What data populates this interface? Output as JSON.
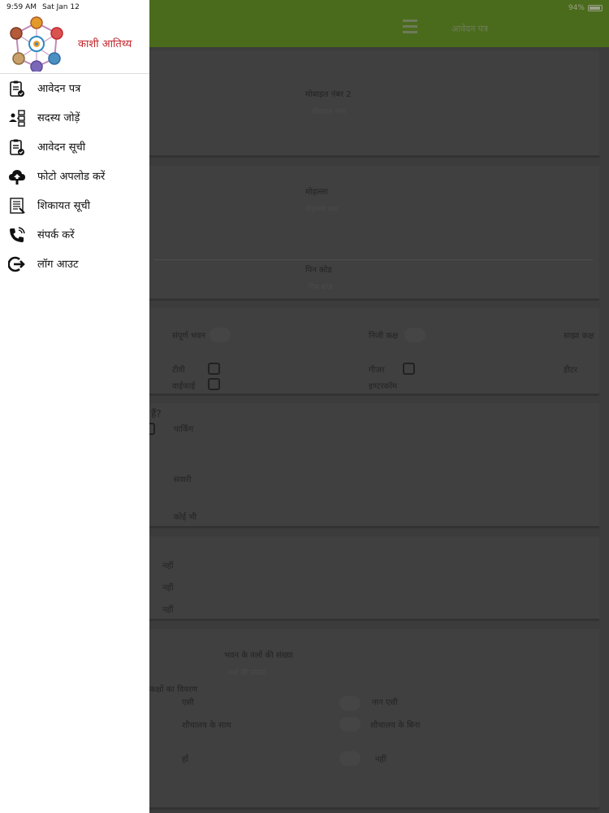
{
  "status_bar": {
    "time": "9:59 AM",
    "date": "Sat Jan 12",
    "battery": "94%"
  },
  "drawer": {
    "brand_name": "काशी आतिथ्य",
    "menu": [
      {
        "label": "आवेदन पत्र",
        "icon": "clipboard-check-icon"
      },
      {
        "label": "सदस्य जोड़ें",
        "icon": "add-member-icon"
      },
      {
        "label": "आवेदन सूची",
        "icon": "clipboard-list-icon"
      },
      {
        "label": "फोटो अपलोड करें",
        "icon": "cloud-upload-icon"
      },
      {
        "label": "शिकायत सूची",
        "icon": "document-list-icon"
      },
      {
        "label": "संपर्क करें",
        "icon": "phone-icon"
      },
      {
        "label": "लॉग आउट",
        "icon": "logout-icon"
      }
    ]
  },
  "background": {
    "header_title": "आवेदन पत्र",
    "mobile2_label": "मोबाइल नंबर 2",
    "mobile2_placeholder": "मोबाइल नंबर",
    "mohalla_label": "मोहल्ला",
    "mohalla_placeholder": "मोहल्ला नाम",
    "pincode_label": "पिन कोड",
    "pincode_placeholder": "पिन कोड",
    "room_types": [
      "संपूर्ण भवन",
      "निजी कक्ष",
      "साझा कक्ष"
    ],
    "amenities": [
      "टीवी",
      "गीजर",
      "हीटर",
      "वाईफाई",
      "इण्टरकॉम"
    ],
    "question_tail": "हैं?",
    "options": [
      "पार्किंग",
      "सवारी",
      "कोई भी"
    ],
    "no_options": [
      "नहीं",
      "नहीं",
      "नहीं"
    ],
    "floors_label": "भवन के तलों की संख्या",
    "floors_placeholder": "तलों की संख्या",
    "rooms_detail": "कक्षों का विवरण",
    "ac": "एसी",
    "non_ac": "नान एसी",
    "with_toilet": "शौचालय के साथ",
    "without_toilet": "शौचालय के बिना",
    "yes": "हाँ",
    "no": "नहीं"
  }
}
